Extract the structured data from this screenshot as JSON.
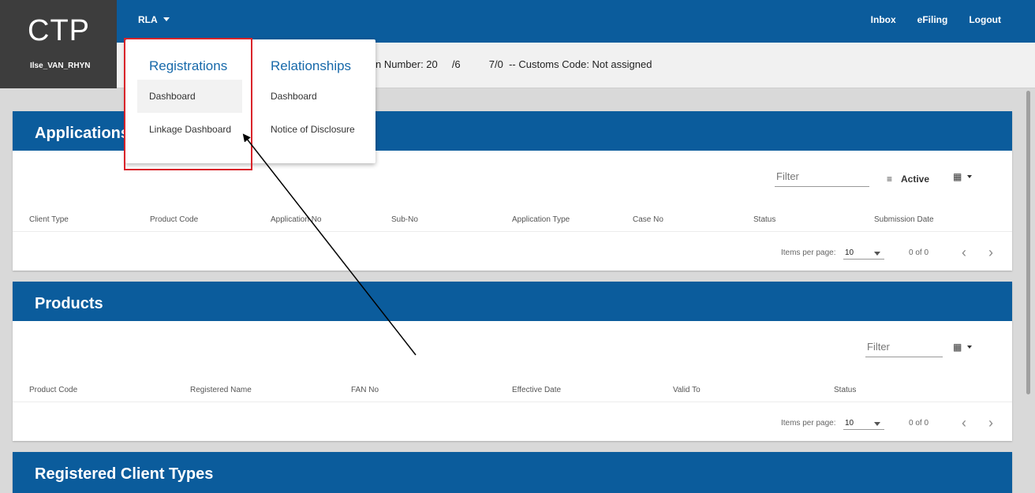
{
  "app": {
    "logo": "CTP",
    "username": "Ilse_VAN_RHYN"
  },
  "topbar": {
    "rla_label": "RLA",
    "nav": [
      "Inbox",
      "eFiling",
      "Logout"
    ]
  },
  "infobar": {
    "text": "n Number: 20     /6          7/0  -- Customs Code: Not assigned"
  },
  "menu": {
    "registrations": {
      "heading": "Registrations",
      "items": [
        "Dashboard",
        "Linkage Dashboard"
      ]
    },
    "relationships": {
      "heading": "Relationships",
      "items": [
        "Dashboard",
        "Notice of Disclosure"
      ]
    }
  },
  "applications": {
    "title": "Applications",
    "filter_placeholder": "Filter",
    "active_label": "Active",
    "columns": [
      "Client Type",
      "Product Code",
      "Application No",
      "Sub-No",
      "Application Type",
      "Case No",
      "Status",
      "Submission Date"
    ],
    "pager": {
      "items_per_page_label": "Items per page:",
      "page_size": "10",
      "range": "0 of 0"
    }
  },
  "products": {
    "title": "Products",
    "filter_placeholder": "Filter",
    "columns": [
      "Product Code",
      "Registered Name",
      "FAN No",
      "Effective Date",
      "Valid To",
      "Status"
    ],
    "pager": {
      "items_per_page_label": "Items per page:",
      "page_size": "10",
      "range": "0 of 0"
    }
  },
  "registered_client_types": {
    "title": "Registered Client Types"
  },
  "icons": {
    "rla_dropdown": "chevron-down-icon",
    "filter": "filter-icon",
    "columns": "grid-icon",
    "prev": "chevron-left-icon",
    "next": "chevron-right-icon"
  },
  "colors": {
    "primary": "#0b5c9c",
    "brand_bg": "#3d3d3d",
    "highlight_box": "#d9242a",
    "menu_heading": "#1769aa"
  }
}
